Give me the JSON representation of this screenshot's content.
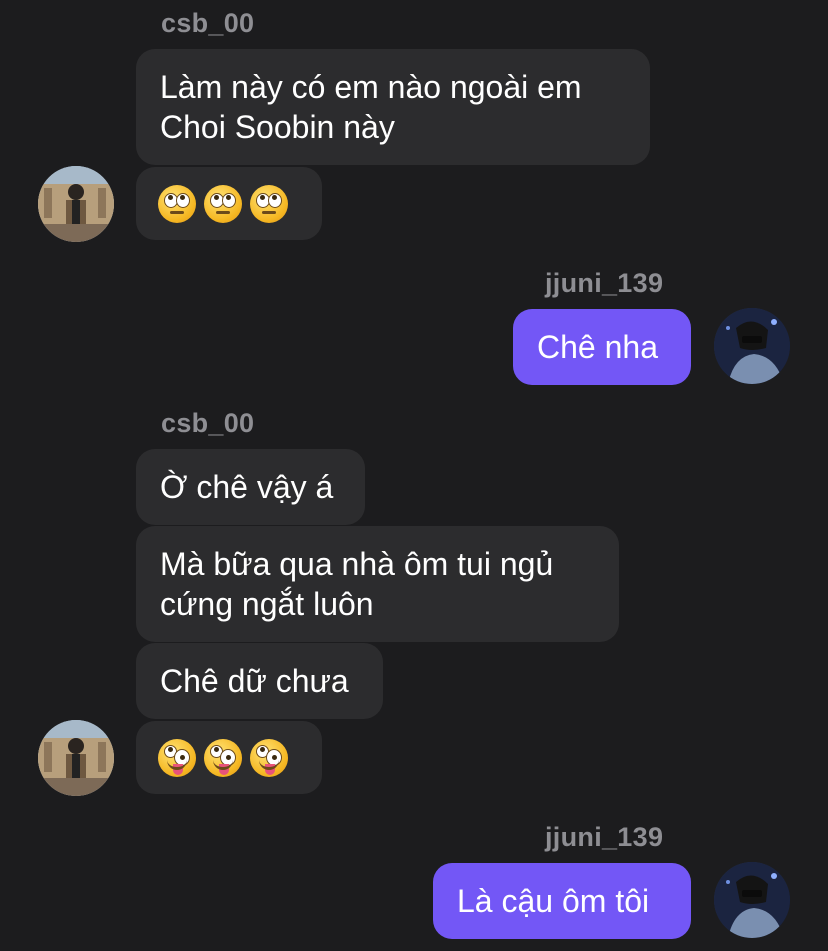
{
  "messages": [
    {
      "sender": "csb_00",
      "text": "Làm này có em nào ngoài em Choi Soobin này"
    },
    {
      "sender": "csb_00",
      "emojis": [
        "face-with-rolling-eyes",
        "face-with-rolling-eyes",
        "face-with-rolling-eyes"
      ]
    },
    {
      "sender": "jjuni_139",
      "text": "Chê nha"
    },
    {
      "sender": "csb_00",
      "text": "Ờ chê vậy á"
    },
    {
      "sender": "csb_00",
      "text": "Mà bữa qua nhà ôm tui ngủ cứng ngắt luôn"
    },
    {
      "sender": "csb_00",
      "text": "Chê dữ chưa"
    },
    {
      "sender": "csb_00",
      "emojis": [
        "zany-face",
        "zany-face",
        "zany-face"
      ]
    },
    {
      "sender": "jjuni_139",
      "text": "Là cậu ôm tôi"
    }
  ],
  "colors": {
    "background": "#1c1c1e",
    "incoming_bubble": "#2c2c2e",
    "outgoing_bubble": "#7357f6",
    "username": "#8e8e93"
  }
}
